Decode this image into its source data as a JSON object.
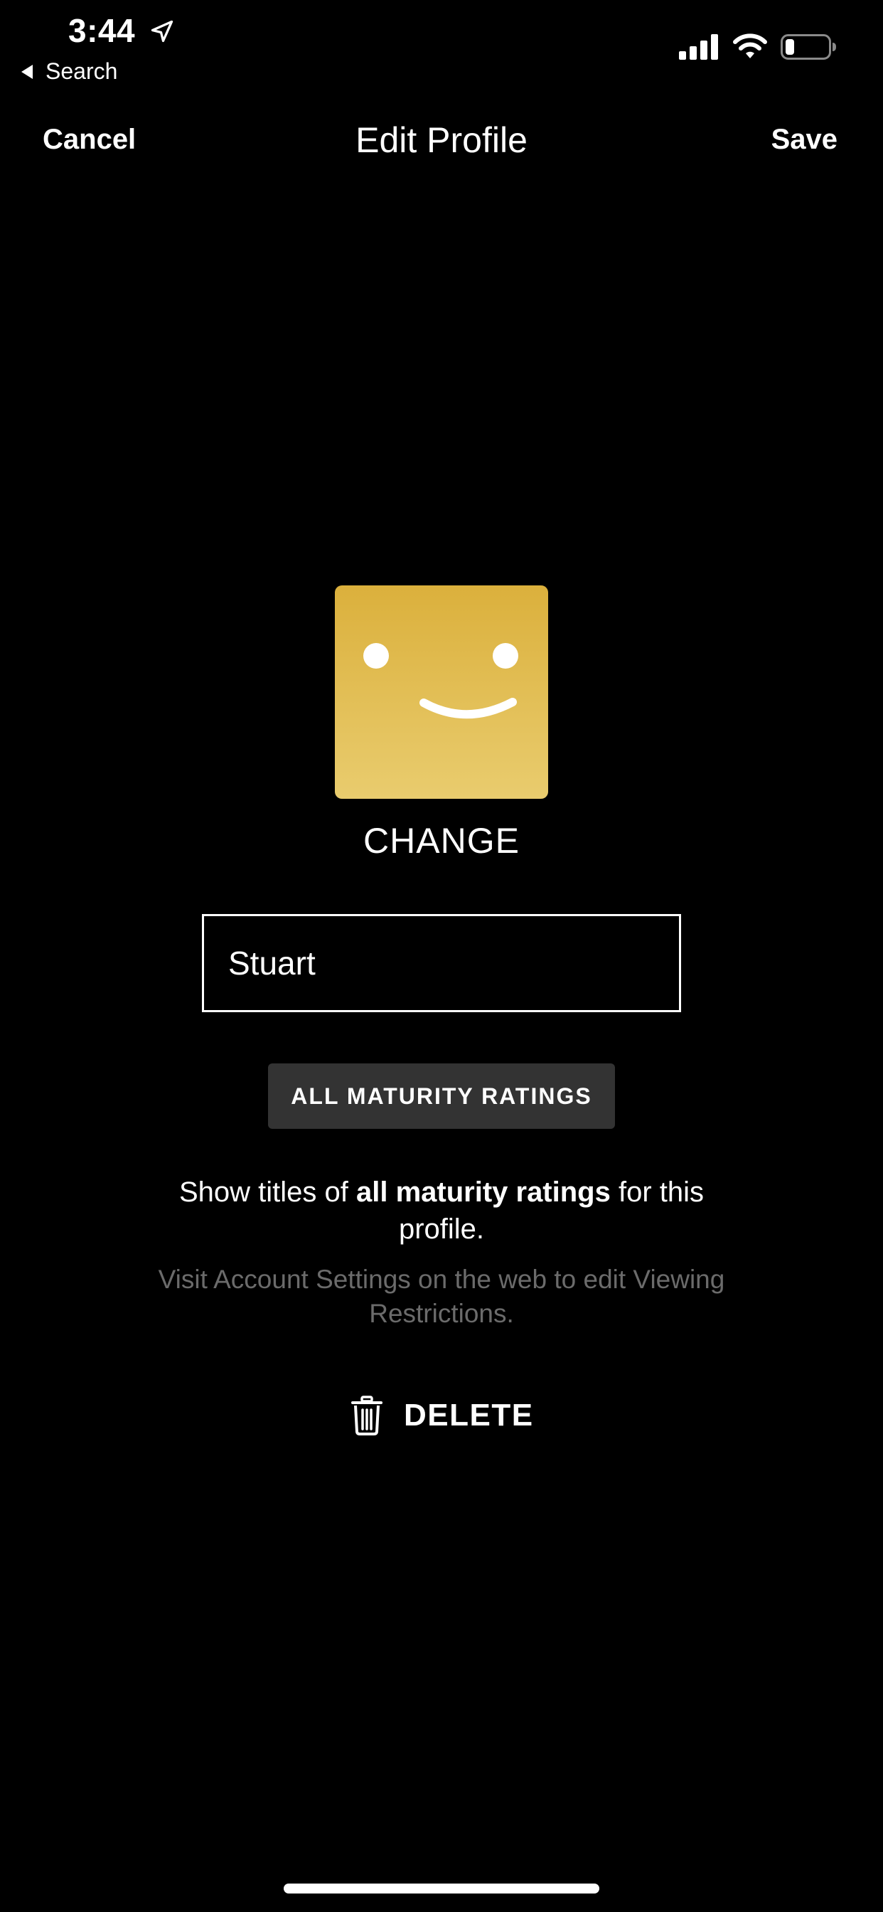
{
  "status_bar": {
    "time": "3:44",
    "back_app": "Search",
    "icons": [
      "location-arrow-icon",
      "cellular-signal-icon",
      "wifi-icon",
      "battery-icon"
    ]
  },
  "nav": {
    "cancel_label": "Cancel",
    "title": "Edit Profile",
    "save_label": "Save"
  },
  "profile": {
    "avatar_icon": "smiley-avatar-icon",
    "avatar_color": "#e0b84a",
    "change_label": "CHANGE",
    "name_value": "Stuart"
  },
  "maturity": {
    "button_label": "ALL MATURITY RATINGS",
    "desc_prefix": "Show titles of ",
    "desc_bold": "all maturity ratings",
    "desc_suffix": " for this profile.",
    "note": "Visit Account Settings on the web to edit Viewing Restrictions."
  },
  "delete": {
    "label": "DELETE",
    "icon": "trash-icon"
  }
}
